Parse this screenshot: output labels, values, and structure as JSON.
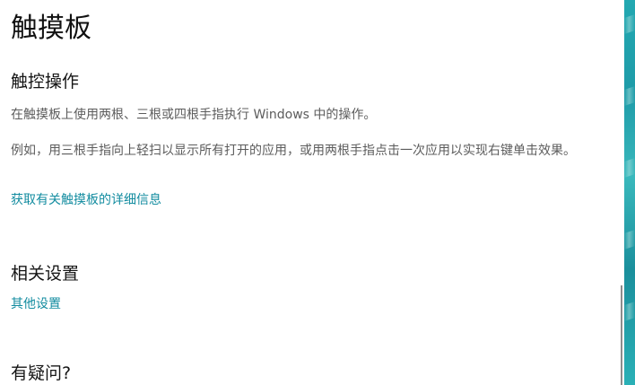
{
  "page": {
    "title": "触摸板"
  },
  "touch_actions": {
    "title": "触控操作",
    "description": "在触摸板上使用两根、三根或四根手指执行 Windows 中的操作。",
    "example": "例如，用三根手指向上轻扫以显示所有打开的应用，或用两根手指点击一次应用以实现右键单击效果。",
    "link": "获取有关触摸板的详细信息"
  },
  "related_settings": {
    "title": "相关设置",
    "link": "其他设置"
  },
  "questions": {
    "title": "有疑问?"
  },
  "colors": {
    "background": "#ffffff",
    "link": "#138ca0",
    "body_text": "#5c5c5c",
    "title_text": "#111111",
    "edge": "#23a8b1"
  }
}
